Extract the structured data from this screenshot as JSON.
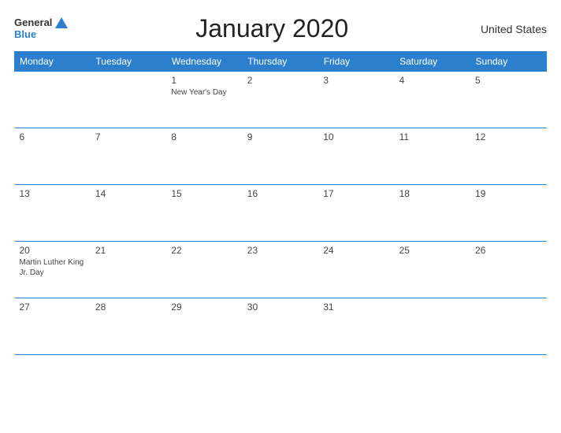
{
  "header": {
    "logo_general": "General",
    "logo_blue": "Blue",
    "title": "January 2020",
    "country": "United States"
  },
  "days_of_week": [
    "Monday",
    "Tuesday",
    "Wednesday",
    "Thursday",
    "Friday",
    "Saturday",
    "Sunday"
  ],
  "weeks": [
    [
      {
        "day": "",
        "holiday": ""
      },
      {
        "day": "",
        "holiday": ""
      },
      {
        "day": "1",
        "holiday": "New Year's Day"
      },
      {
        "day": "2",
        "holiday": ""
      },
      {
        "day": "3",
        "holiday": ""
      },
      {
        "day": "4",
        "holiday": ""
      },
      {
        "day": "5",
        "holiday": ""
      }
    ],
    [
      {
        "day": "6",
        "holiday": ""
      },
      {
        "day": "7",
        "holiday": ""
      },
      {
        "day": "8",
        "holiday": ""
      },
      {
        "day": "9",
        "holiday": ""
      },
      {
        "day": "10",
        "holiday": ""
      },
      {
        "day": "11",
        "holiday": ""
      },
      {
        "day": "12",
        "holiday": ""
      }
    ],
    [
      {
        "day": "13",
        "holiday": ""
      },
      {
        "day": "14",
        "holiday": ""
      },
      {
        "day": "15",
        "holiday": ""
      },
      {
        "day": "16",
        "holiday": ""
      },
      {
        "day": "17",
        "holiday": ""
      },
      {
        "day": "18",
        "holiday": ""
      },
      {
        "day": "19",
        "holiday": ""
      }
    ],
    [
      {
        "day": "20",
        "holiday": "Martin Luther King Jr. Day"
      },
      {
        "day": "21",
        "holiday": ""
      },
      {
        "day": "22",
        "holiday": ""
      },
      {
        "day": "23",
        "holiday": ""
      },
      {
        "day": "24",
        "holiday": ""
      },
      {
        "day": "25",
        "holiday": ""
      },
      {
        "day": "26",
        "holiday": ""
      }
    ],
    [
      {
        "day": "27",
        "holiday": ""
      },
      {
        "day": "28",
        "holiday": ""
      },
      {
        "day": "29",
        "holiday": ""
      },
      {
        "day": "30",
        "holiday": ""
      },
      {
        "day": "31",
        "holiday": ""
      },
      {
        "day": "",
        "holiday": ""
      },
      {
        "day": "",
        "holiday": ""
      }
    ]
  ]
}
